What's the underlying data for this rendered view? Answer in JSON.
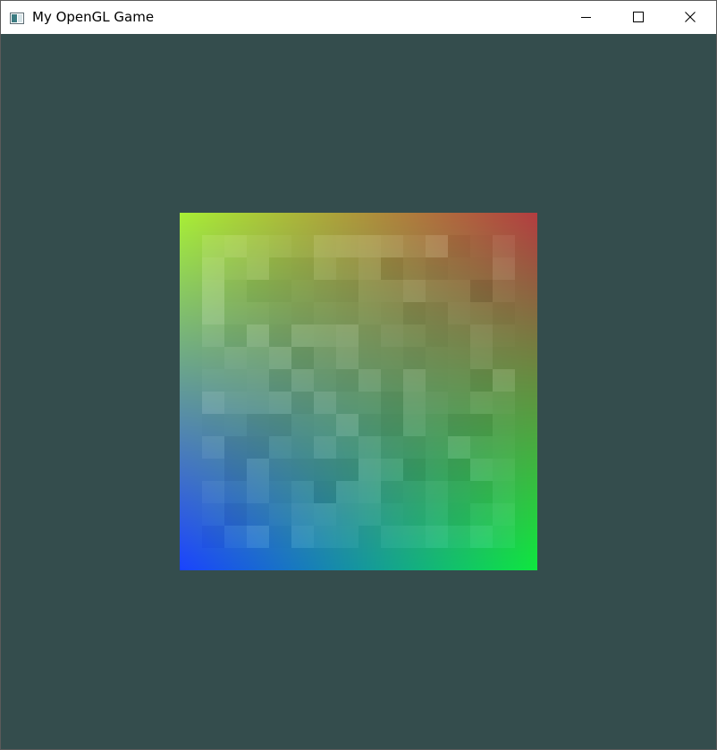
{
  "window": {
    "title": "My OpenGL Game",
    "icon": "app-window-icon",
    "controls": {
      "minimize_icon": "minimize-icon",
      "maximize_icon": "maximize-icon",
      "close_icon": "close-icon"
    }
  },
  "scene": {
    "clear_color": "#344d4d",
    "quad": {
      "corner_colors": {
        "top_left": "#a8ef35",
        "top_right": "#b33d40",
        "bottom_left": "#1a43ff",
        "bottom_right": "#0ee83f"
      },
      "texture": "pixelated-square-pattern"
    }
  }
}
